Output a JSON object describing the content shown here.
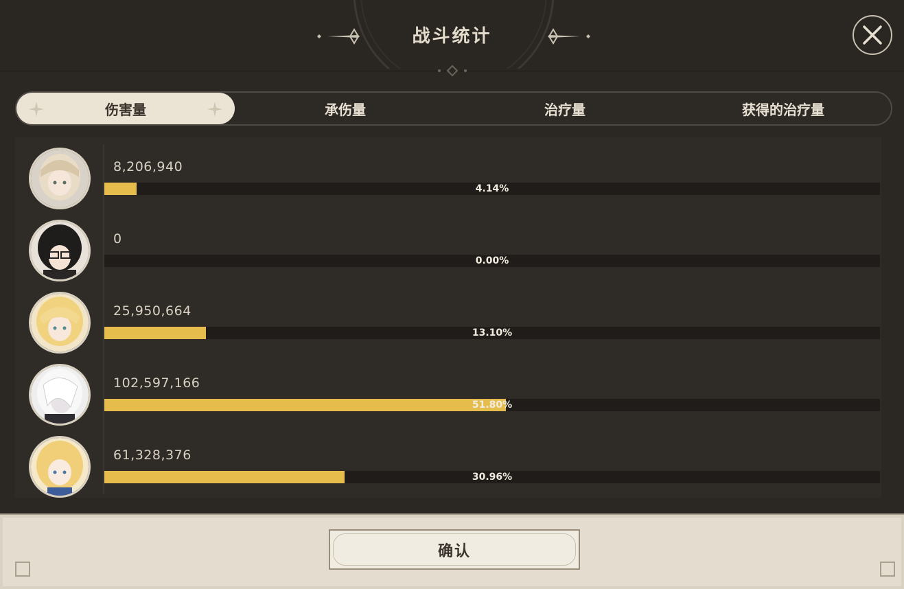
{
  "dialog": {
    "title": "战斗统计",
    "close_icon": "close-icon"
  },
  "tabs": [
    {
      "label": "伤害量",
      "active": true
    },
    {
      "label": "承伤量",
      "active": false
    },
    {
      "label": "治疗量",
      "active": false
    },
    {
      "label": "获得的治疗量",
      "active": false
    }
  ],
  "rows": [
    {
      "value": "8,206,940",
      "percent_label": "4.14%",
      "fraction": 0.0414
    },
    {
      "value": "0",
      "percent_label": "0.00%",
      "fraction": 0.0
    },
    {
      "value": "25,950,664",
      "percent_label": "13.10%",
      "fraction": 0.131
    },
    {
      "value": "102,597,166",
      "percent_label": "51.80%",
      "fraction": 0.518
    },
    {
      "value": "61,328,376",
      "percent_label": "30.96%",
      "fraction": 0.3096
    }
  ],
  "footer": {
    "confirm_label": "确认"
  },
  "colors": {
    "bar_fill": "#e6bd4c",
    "panel_bg": "#2b2723",
    "tab_active_bg": "#ebe3d4"
  }
}
